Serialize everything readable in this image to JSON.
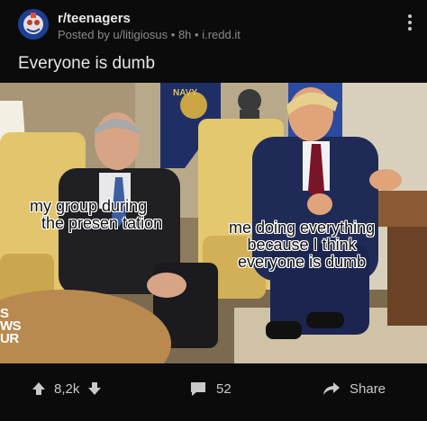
{
  "post": {
    "subreddit": "r/teenagers",
    "posted_by": "Posted by u/litigiosus",
    "separator": "•",
    "age": "8h",
    "domain": "i.redd.it",
    "title": "Everyone is dumb"
  },
  "meme": {
    "caption_left_line1": "my group during",
    "caption_left_line2": "the presen tation",
    "caption_right_line1": "me doing everything",
    "caption_right_line2": "because I think",
    "caption_right_line3": "everyone is dumb",
    "flag_text": "NAVY",
    "watermark_line1": "S",
    "watermark_line2": "WS",
    "watermark_line3": "UR"
  },
  "actions": {
    "score": "8,2k",
    "comments": "52",
    "share_label": "Share"
  },
  "icons": [
    "more-options-icon",
    "upvote-icon",
    "downvote-icon",
    "comment-icon",
    "share-icon"
  ],
  "colors": {
    "background": "#0b0b0b",
    "text": "#d7dadc",
    "muted": "#8a8a8a"
  }
}
